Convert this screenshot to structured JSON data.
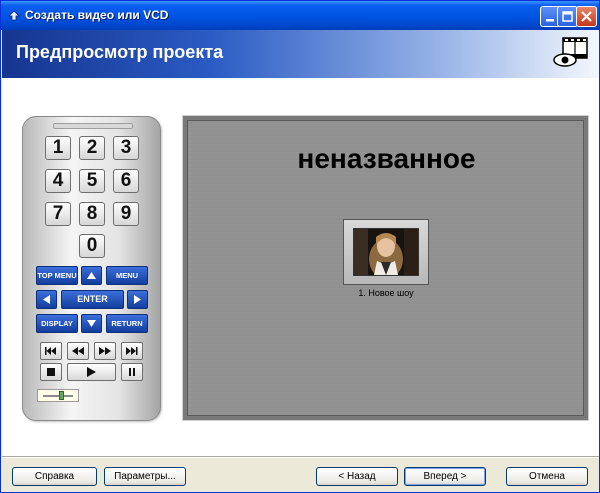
{
  "window": {
    "title": "Создать видео или VCD"
  },
  "header": {
    "title": "Предпросмотр проекта",
    "icon": "film-eye-icon"
  },
  "remote": {
    "digits": [
      "1",
      "2",
      "3",
      "4",
      "5",
      "6",
      "7",
      "8",
      "9",
      "0"
    ],
    "buttons": {
      "top_menu": "TOP MENU",
      "menu": "MENU",
      "enter": "ENTER",
      "display": "DISPLAY",
      "return": "RETURN"
    },
    "volume_level": 0.6
  },
  "preview": {
    "menu_title": "неназванное",
    "items": [
      {
        "label": "1. Новое шоу"
      }
    ]
  },
  "footer": {
    "help": "Справка",
    "params": "Параметры...",
    "back": "< Назад",
    "next": "Вперед >",
    "cancel": "Отмена"
  },
  "colors": {
    "titlebar": "#0055E5",
    "accent": "#2A5BC4"
  }
}
